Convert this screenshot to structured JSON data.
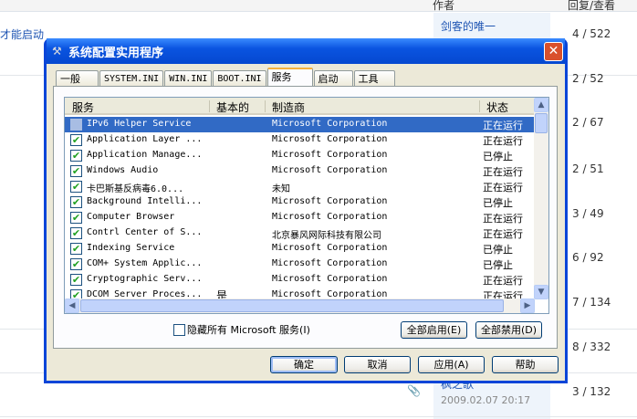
{
  "background": {
    "header": {
      "author": "作者",
      "replies": "回复/查看"
    },
    "topic_fragment": "才能启动",
    "authors": [
      "剑客的唯一",
      "枫之歌"
    ],
    "date": "2009.02.07 20:17",
    "counts": [
      "4 / 522",
      "2 / 52",
      "2 / 67",
      "2 / 51",
      "3 / 49",
      "6 / 92",
      "7 / 134",
      "8 / 332",
      "3 / 132"
    ]
  },
  "dialog": {
    "title": "系统配置实用程序",
    "tabs": [
      {
        "label": "一般"
      },
      {
        "label": "SYSTEM.INI"
      },
      {
        "label": "WIN.INI"
      },
      {
        "label": "BOOT.INI"
      },
      {
        "label": "服务",
        "active": true
      },
      {
        "label": "启动"
      },
      {
        "label": "工具"
      }
    ],
    "columns": [
      "服务",
      "基本的",
      "制造商",
      "状态"
    ],
    "rows": [
      {
        "name": "IPv6 Helper Service",
        "essential": "",
        "vendor": "Microsoft Corporation",
        "status": "正在运行",
        "checked": false,
        "selected": true
      },
      {
        "name": "Application Layer ...",
        "essential": "",
        "vendor": "Microsoft Corporation",
        "status": "正在运行",
        "checked": true
      },
      {
        "name": "Application Manage...",
        "essential": "",
        "vendor": "Microsoft Corporation",
        "status": "已停止",
        "checked": true
      },
      {
        "name": "Windows Audio",
        "essential": "",
        "vendor": "Microsoft Corporation",
        "status": "正在运行",
        "checked": true
      },
      {
        "name": "卡巴斯基反病毒6.0...",
        "essential": "",
        "vendor": "未知",
        "status": "正在运行",
        "checked": true
      },
      {
        "name": "Background Intelli...",
        "essential": "",
        "vendor": "Microsoft Corporation",
        "status": "已停止",
        "checked": true
      },
      {
        "name": "Computer Browser",
        "essential": "",
        "vendor": "Microsoft Corporation",
        "status": "正在运行",
        "checked": true
      },
      {
        "name": "Contrl Center of S...",
        "essential": "",
        "vendor": "北京暴风网际科技有限公司",
        "status": "正在运行",
        "checked": true
      },
      {
        "name": "Indexing Service",
        "essential": "",
        "vendor": "Microsoft Corporation",
        "status": "已停止",
        "checked": true
      },
      {
        "name": "COM+ System Applic...",
        "essential": "",
        "vendor": "Microsoft Corporation",
        "status": "已停止",
        "checked": true
      },
      {
        "name": "Cryptographic Serv...",
        "essential": "",
        "vendor": "Microsoft Corporation",
        "status": "正在运行",
        "checked": true
      },
      {
        "name": "DCOM Server Proces...",
        "essential": "是",
        "vendor": "Microsoft Corporation",
        "status": "正在运行",
        "checked": true
      }
    ],
    "hide_ms_label": "隐藏所有 Microsoft 服务(I)",
    "enable_all": "全部启用(E)",
    "disable_all": "全部禁用(D)",
    "ok": "确定",
    "cancel": "取消",
    "apply": "应用(A)",
    "help": "帮助"
  }
}
